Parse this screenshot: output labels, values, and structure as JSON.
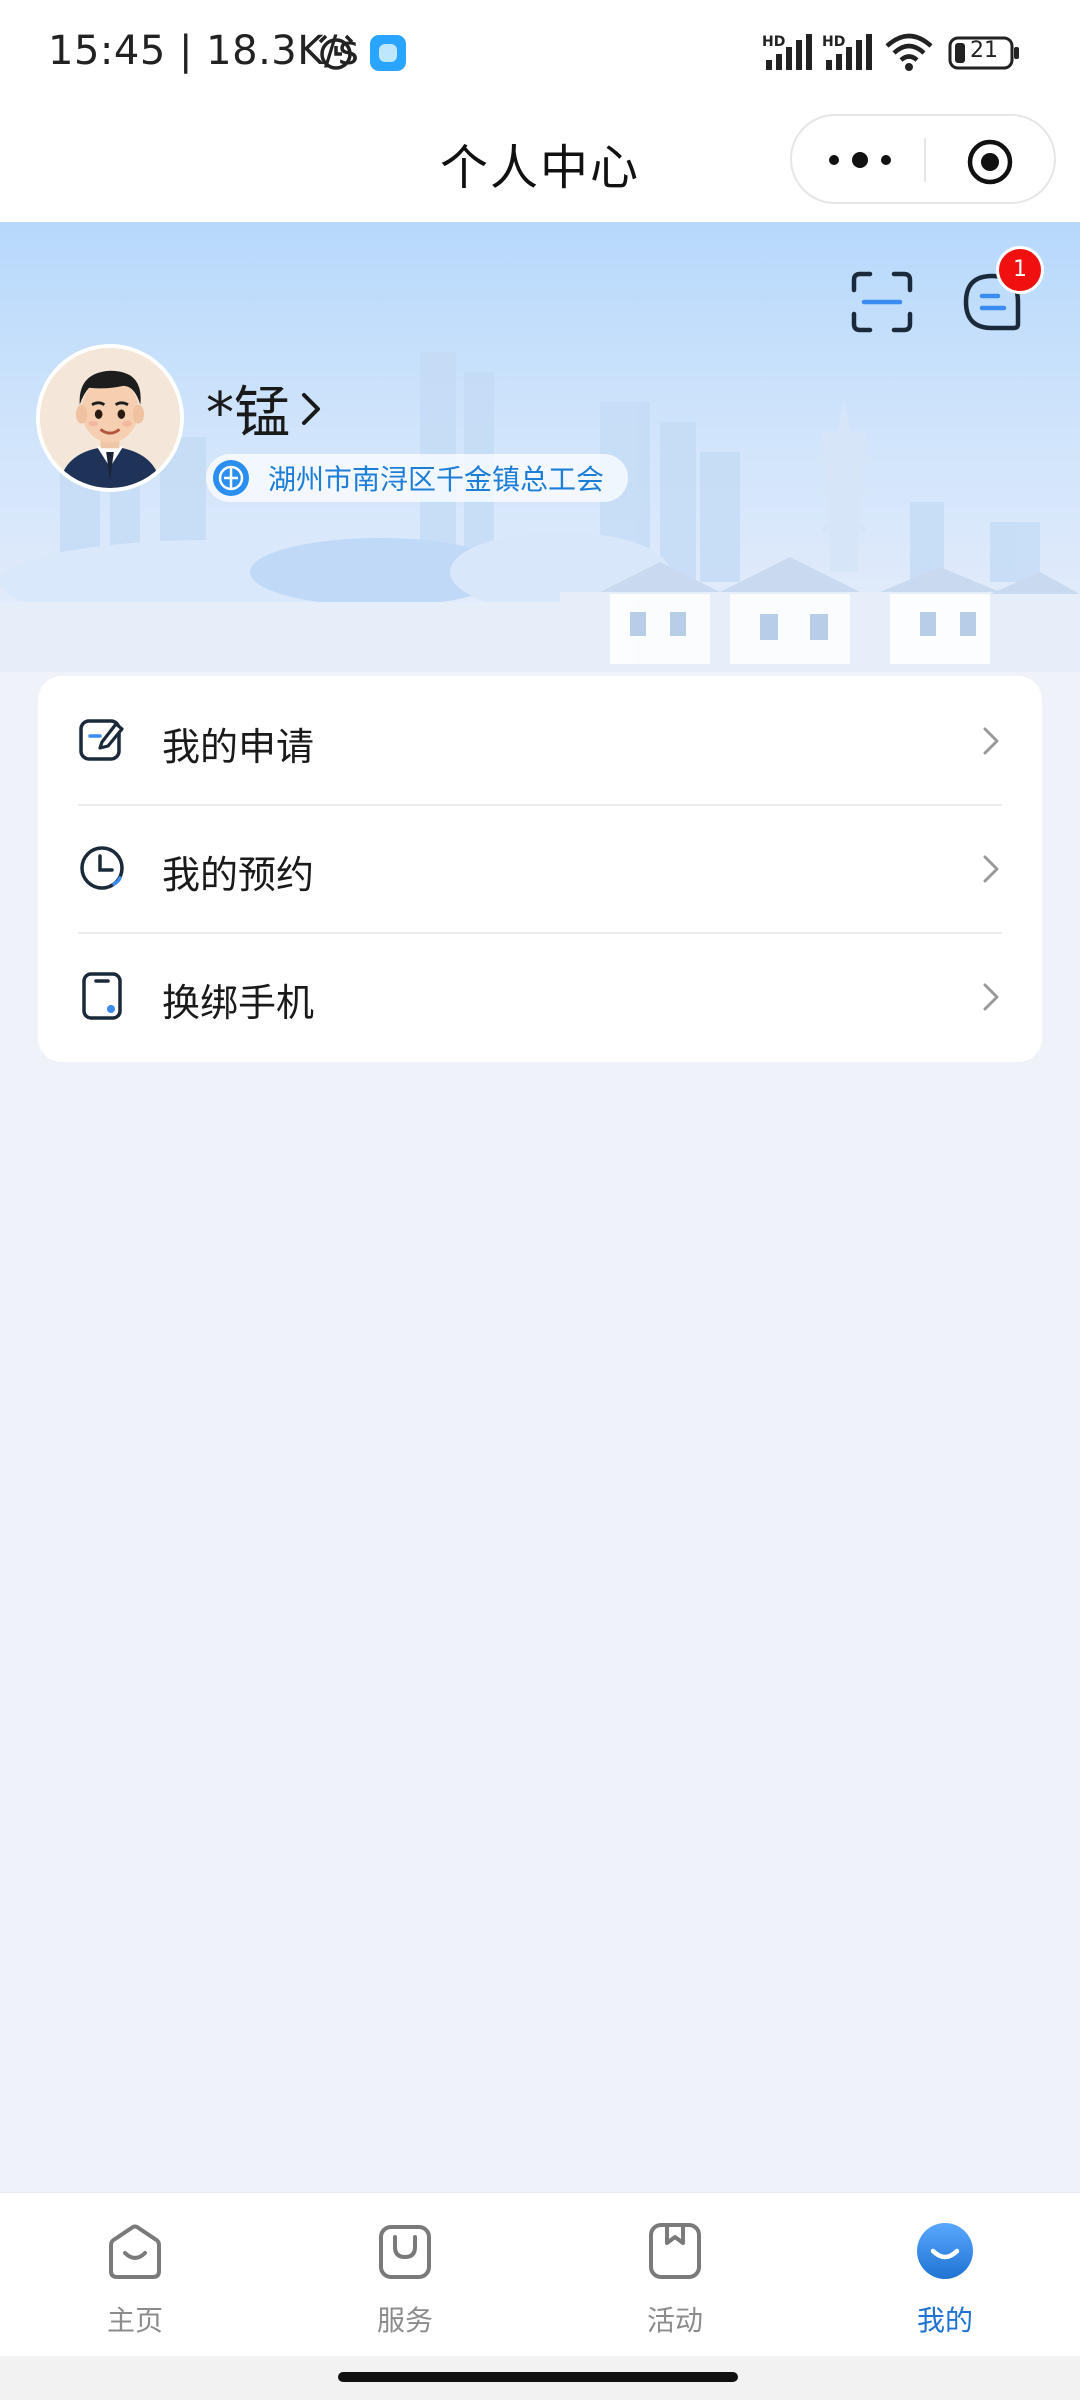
{
  "status_bar": {
    "time": "15:45 | 18.3K/s",
    "signal_tags": [
      "HD",
      "HD"
    ],
    "battery": "21"
  },
  "header": {
    "title": "个人中心"
  },
  "profile": {
    "name": "*锰",
    "organization": "湖州市南浔区千金镇总工会",
    "message_badge": "1"
  },
  "menu": {
    "items": [
      {
        "label": "我的申请",
        "icon": "edit-icon"
      },
      {
        "label": "我的预约",
        "icon": "clock-icon"
      },
      {
        "label": "换绑手机",
        "icon": "phone-icon"
      }
    ]
  },
  "tabbar": {
    "items": [
      {
        "label": "主页",
        "icon": "home-icon",
        "active": false
      },
      {
        "label": "服务",
        "icon": "bag-icon",
        "active": false
      },
      {
        "label": "活动",
        "icon": "bookmark-icon",
        "active": false
      },
      {
        "label": "我的",
        "icon": "profile-icon",
        "active": true
      }
    ]
  },
  "colors": {
    "accent": "#1e73d2",
    "badge": "#f01010",
    "background": "#eff3f9"
  }
}
